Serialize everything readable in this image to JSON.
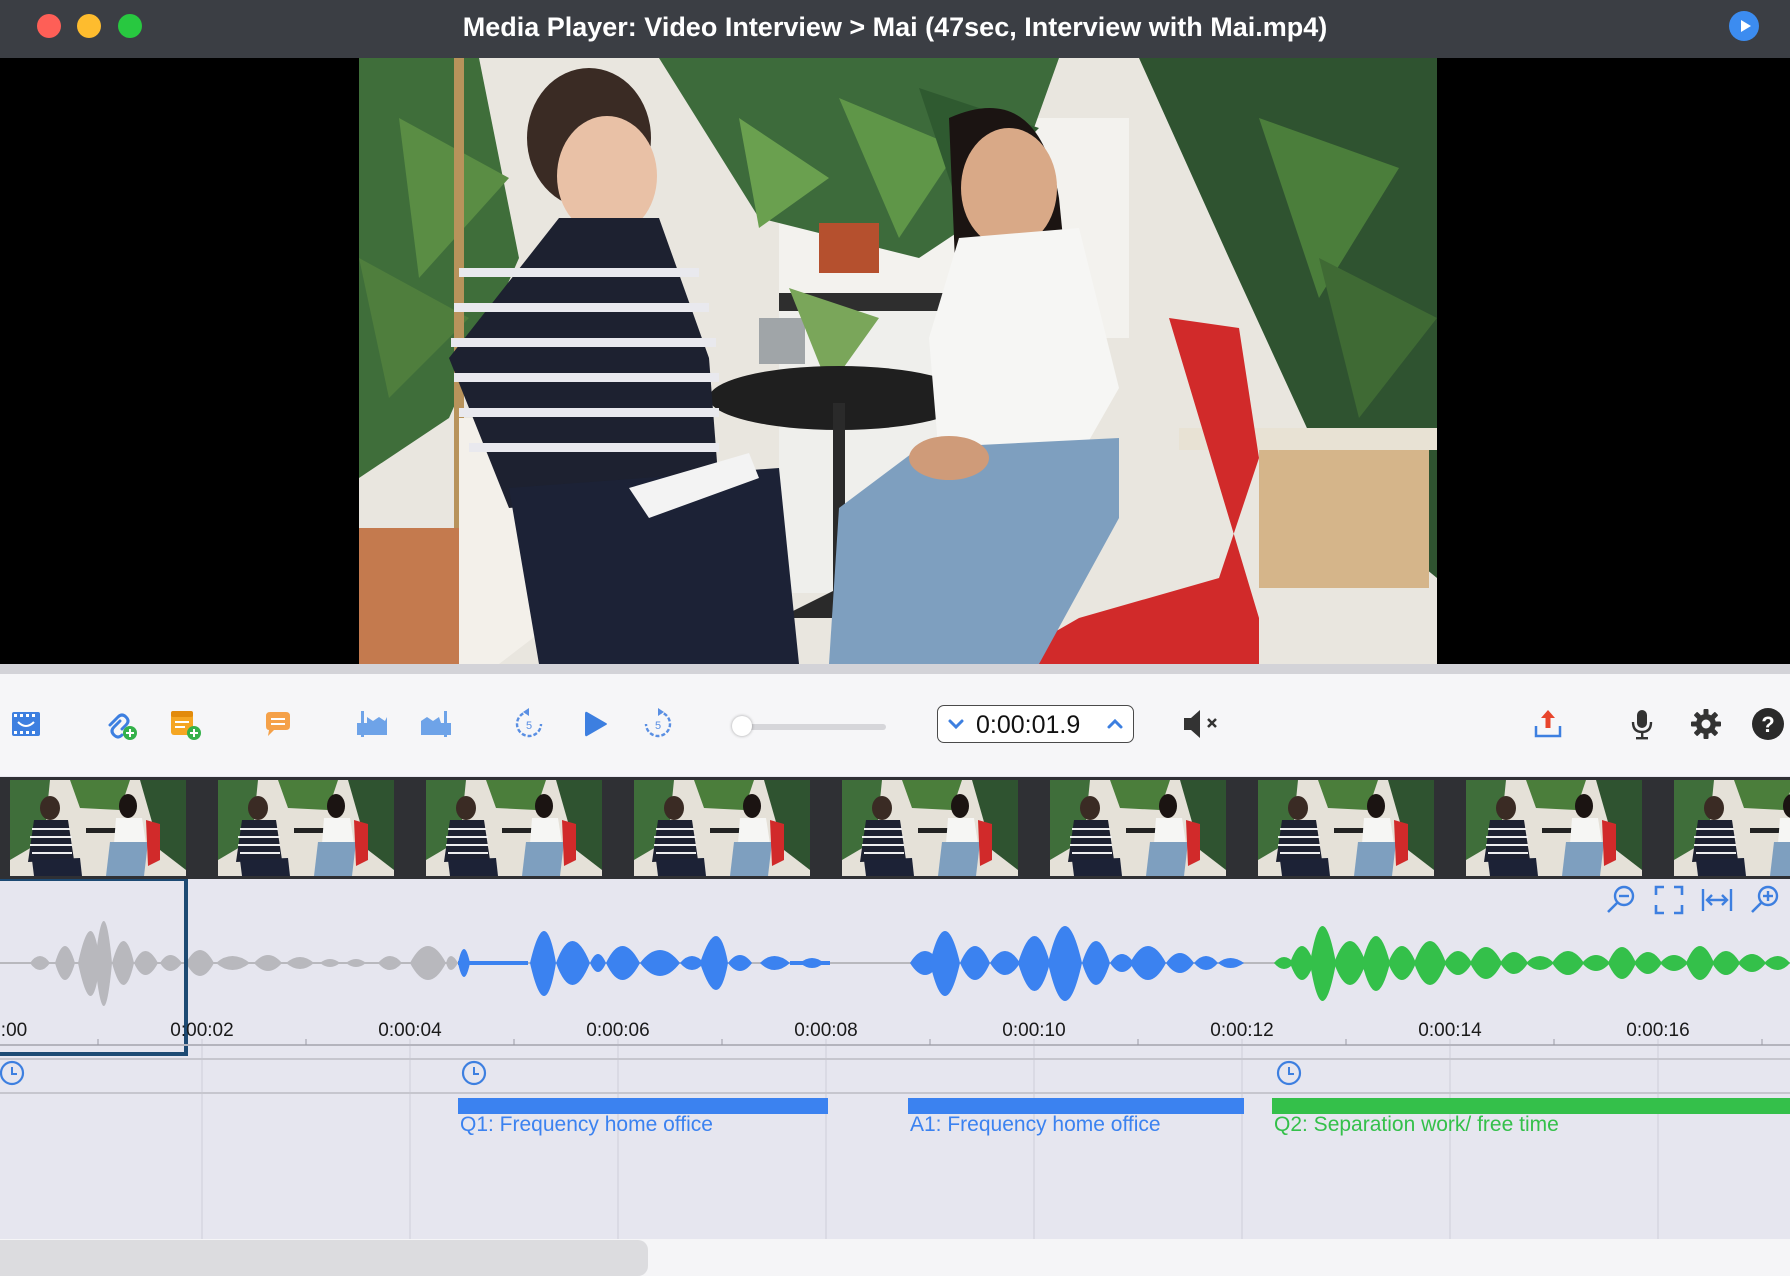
{
  "window": {
    "title": "Media Player: Video Interview > Mai (47sec, Interview with Mai.mp4)"
  },
  "toolbar": {
    "time": "0:00:01.9",
    "buttons": [
      {
        "name": "video-strip-icon"
      },
      {
        "name": "add-link-icon"
      },
      {
        "name": "add-document-icon"
      },
      {
        "name": "comment-icon"
      },
      {
        "name": "clip-start-icon"
      },
      {
        "name": "clip-end-icon"
      },
      {
        "name": "rewind-5-icon"
      },
      {
        "name": "play-icon"
      },
      {
        "name": "forward-5-icon"
      },
      {
        "name": "mute-icon"
      },
      {
        "name": "export-icon"
      },
      {
        "name": "microphone-icon"
      },
      {
        "name": "settings-icon"
      },
      {
        "name": "help-icon"
      }
    ],
    "volume_level": 0
  },
  "timeline": {
    "ticks": [
      ":00",
      "0:00:02",
      "0:00:04",
      "0:00:06",
      "0:00:08",
      "0:00:10",
      "0:00:12",
      "0:00:14",
      "0:00:16"
    ],
    "segments": [
      {
        "label": "Q1: Frequency home office",
        "color": "#3b82f0"
      },
      {
        "label": "A1: Frequency home office",
        "color": "#3b82f0"
      },
      {
        "label": "Q2: Separation work/ free time",
        "color": "#34c04a"
      }
    ],
    "zoom_controls": [
      "zoom-out-icon",
      "fit-icon",
      "stretch-icon",
      "zoom-in-icon"
    ]
  },
  "colors": {
    "accent_blue": "#3b82f0",
    "accent_green": "#34c04a",
    "titlebar": "#3b3e44",
    "waveform_gray": "#b8b8bd"
  }
}
